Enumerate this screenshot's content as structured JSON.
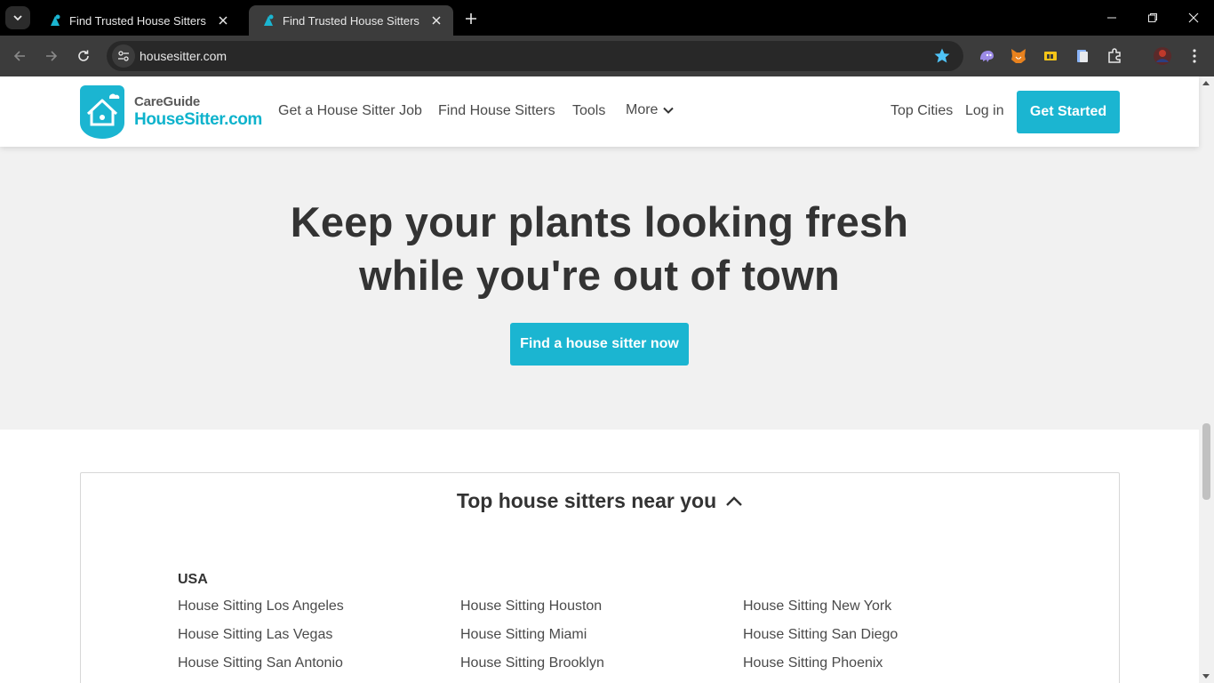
{
  "browser": {
    "tabs": [
      {
        "title": "Find Trusted House Sitters | Hou",
        "active": false
      },
      {
        "title": "Find Trusted House Sitters | Hou",
        "active": true
      }
    ],
    "url": "housesitter.com"
  },
  "header": {
    "logo_top": "CareGuide",
    "logo_bottom": "HouseSitter.com",
    "nav": {
      "job": "Get a House Sitter Job",
      "find": "Find House Sitters",
      "tools": "Tools",
      "more": "More"
    },
    "top_cities": "Top Cities",
    "login": "Log in",
    "cta": "Get Started"
  },
  "hero": {
    "line1": "Keep your plants looking fresh",
    "line2": "while you're out of town",
    "button": "Find a house sitter now"
  },
  "cities": {
    "heading": "Top house sitters near you",
    "country": "USA",
    "columns": [
      [
        "House Sitting Los Angeles",
        "House Sitting Las Vegas",
        "House Sitting San Antonio"
      ],
      [
        "House Sitting Houston",
        "House Sitting Miami",
        "House Sitting Brooklyn"
      ],
      [
        "House Sitting New York",
        "House Sitting San Diego",
        "House Sitting Phoenix"
      ]
    ]
  },
  "colors": {
    "brand": "#1bb5d1",
    "text": "#333333"
  }
}
